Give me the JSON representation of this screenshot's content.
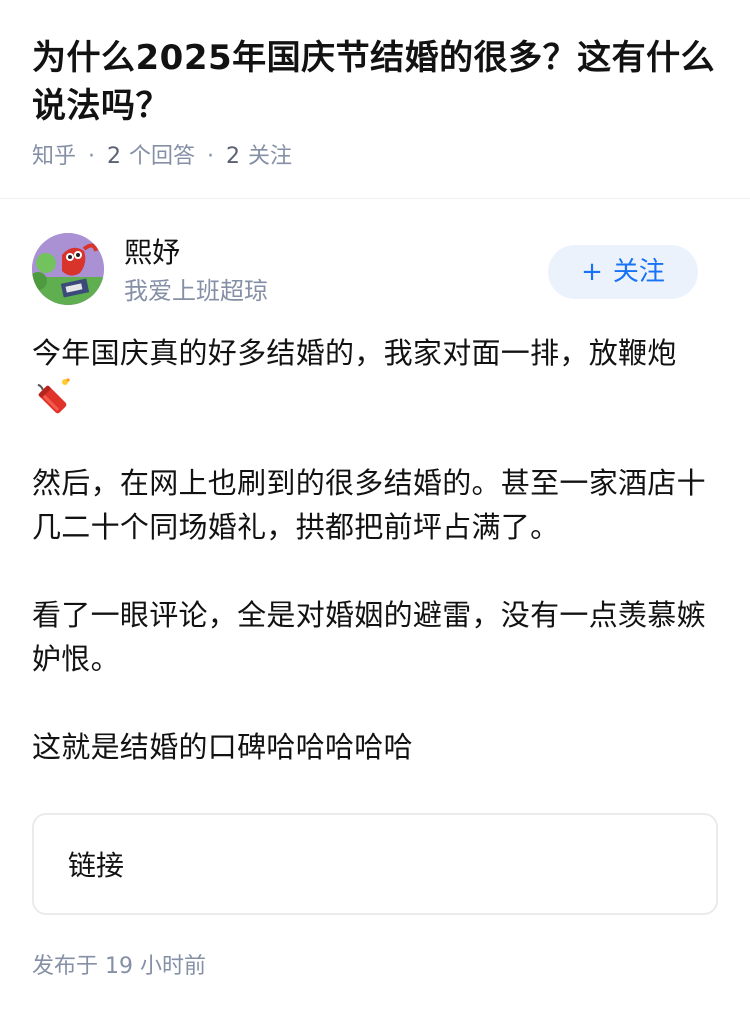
{
  "question": {
    "title": "为什么2025年国庆节结婚的很多？这有什么说法吗？",
    "source": "知乎",
    "answers_count": "2",
    "answers_label": "个回答",
    "followers_count": "2",
    "followers_label": "关注"
  },
  "author": {
    "name": "熙妤",
    "bio": "我爱上班超琼",
    "follow_label": "关注",
    "follow_icon": "+"
  },
  "answer": {
    "paragraphs": [
      "今年国庆真的好多结婚的，我家对面一排，放鞭炮",
      "然后，在网上也刷到的很多结婚的。甚至一家酒店十几二十个同场婚礼，拱都把前坪占满了。",
      "看了一眼评论，全是对婚姻的避雷，没有一点羡慕嫉妒恨。",
      "这就是结婚的口碑哈哈哈哈哈"
    ],
    "emoji": "firecracker-icon"
  },
  "link_card": {
    "label": "链接"
  },
  "publish": {
    "prefix": "发布于",
    "time": "19 小时前"
  },
  "colors": {
    "accent": "#1772f6",
    "accent_bg": "#ebf2fb",
    "meta_text": "#8590a6",
    "primary_text": "#121212"
  }
}
